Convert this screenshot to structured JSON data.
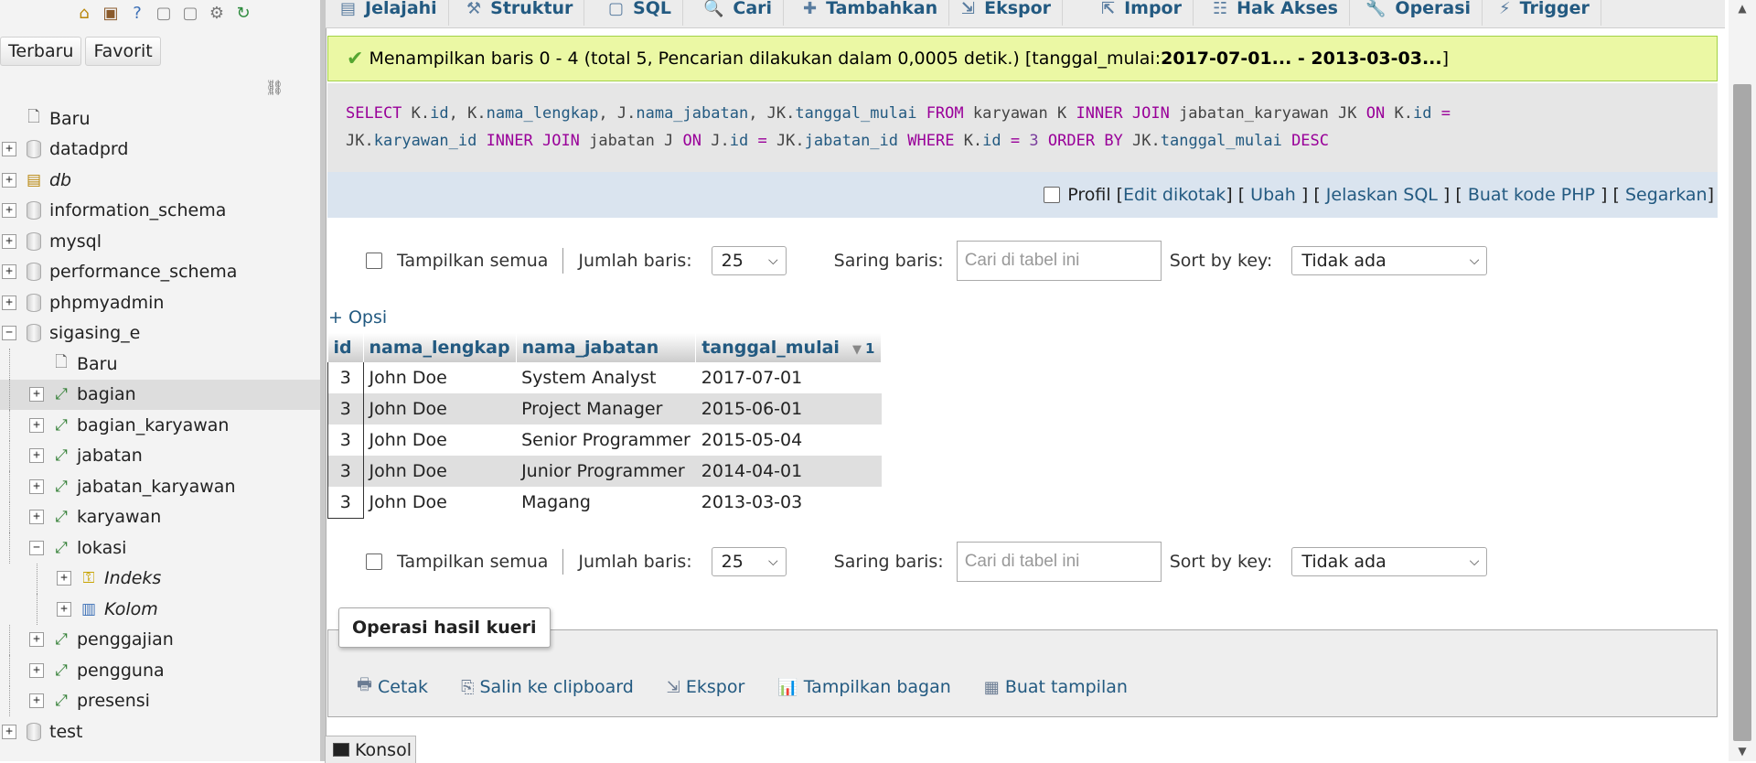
{
  "navigation": {
    "top_icons": [
      {
        "name": "home-icon",
        "glyph": "⌂"
      },
      {
        "name": "logout-icon",
        "glyph": "▣"
      },
      {
        "name": "help-icon",
        "glyph": "?"
      },
      {
        "name": "docs-icon",
        "glyph": "▢"
      },
      {
        "name": "copy-icon",
        "glyph": "▢"
      },
      {
        "name": "settings-icon",
        "glyph": "⚙"
      },
      {
        "name": "reload-icon",
        "glyph": "↻"
      }
    ],
    "tabs": [
      "Terbaru",
      "Favorit"
    ],
    "tree": [
      {
        "label": "Baru",
        "level": 0,
        "expander": "",
        "icon": "new-icon",
        "italic": false
      },
      {
        "label": "datadprd",
        "level": 0,
        "expander": "+",
        "icon": "database-icon",
        "italic": false
      },
      {
        "label": "db",
        "level": 0,
        "expander": "+",
        "icon": "database-group-icon",
        "italic": true
      },
      {
        "label": "information_schema",
        "level": 0,
        "expander": "+",
        "icon": "database-icon",
        "italic": false
      },
      {
        "label": "mysql",
        "level": 0,
        "expander": "+",
        "icon": "database-icon",
        "italic": false
      },
      {
        "label": "performance_schema",
        "level": 0,
        "expander": "+",
        "icon": "database-icon",
        "italic": false
      },
      {
        "label": "phpmyadmin",
        "level": 0,
        "expander": "+",
        "icon": "database-icon",
        "italic": false
      },
      {
        "label": "sigasing_e",
        "level": 0,
        "expander": "−",
        "icon": "database-icon",
        "italic": false
      },
      {
        "label": "Baru",
        "level": 1,
        "expander": "",
        "icon": "new-table-icon",
        "italic": false
      },
      {
        "label": "bagian",
        "level": 1,
        "expander": "+",
        "icon": "table-icon",
        "italic": false,
        "highlight": true
      },
      {
        "label": "bagian_karyawan",
        "level": 1,
        "expander": "+",
        "icon": "table-icon",
        "italic": false
      },
      {
        "label": "jabatan",
        "level": 1,
        "expander": "+",
        "icon": "table-icon",
        "italic": false
      },
      {
        "label": "jabatan_karyawan",
        "level": 1,
        "expander": "+",
        "icon": "table-icon",
        "italic": false
      },
      {
        "label": "karyawan",
        "level": 1,
        "expander": "+",
        "icon": "table-icon",
        "italic": false
      },
      {
        "label": "lokasi",
        "level": 1,
        "expander": "−",
        "icon": "table-icon",
        "italic": false
      },
      {
        "label": "Indeks",
        "level": 2,
        "expander": "+",
        "icon": "index-icon",
        "italic": true
      },
      {
        "label": "Kolom",
        "level": 2,
        "expander": "+",
        "icon": "columns-icon",
        "italic": true
      },
      {
        "label": "penggajian",
        "level": 1,
        "expander": "+",
        "icon": "table-icon",
        "italic": false
      },
      {
        "label": "pengguna",
        "level": 1,
        "expander": "+",
        "icon": "table-icon",
        "italic": false
      },
      {
        "label": "presensi",
        "level": 1,
        "expander": "+",
        "icon": "table-icon",
        "italic": false
      },
      {
        "label": "test",
        "level": 0,
        "expander": "+",
        "icon": "database-icon",
        "italic": false
      }
    ]
  },
  "top_menu": [
    {
      "label": "Jelajahi",
      "icon": "browse-icon"
    },
    {
      "label": "Struktur",
      "icon": "structure-icon"
    },
    {
      "label": "SQL",
      "icon": "sql-icon"
    },
    {
      "label": "Cari",
      "icon": "search-icon"
    },
    {
      "label": "Tambahkan",
      "icon": "insert-icon"
    },
    {
      "label": "Ekspor",
      "icon": "export-icon"
    },
    {
      "label": "Impor",
      "icon": "import-icon"
    },
    {
      "label": "Hak Akses",
      "icon": "privileges-icon"
    },
    {
      "label": "Operasi",
      "icon": "operations-icon"
    },
    {
      "label": "Trigger",
      "icon": "trigger-icon"
    }
  ],
  "notice": {
    "text": "Menampilkan baris 0 - 4 (total 5, Pencarian dilakukan dalam 0,0005 detik.) [tanggal_mulai: ",
    "range": "2017-07-01... - 2013-03-03...",
    "close": "]"
  },
  "sql": {
    "line1": [
      {
        "t": "SELECT",
        "c": "kw"
      },
      {
        "t": " K.",
        "c": ""
      },
      {
        "t": "id",
        "c": "fld"
      },
      {
        "t": ", K.",
        "c": ""
      },
      {
        "t": "nama_lengkap",
        "c": "fld"
      },
      {
        "t": ", J.",
        "c": ""
      },
      {
        "t": "nama_jabatan",
        "c": "fld"
      },
      {
        "t": ", JK.",
        "c": ""
      },
      {
        "t": "tanggal_mulai",
        "c": "fld"
      },
      {
        "t": " ",
        "c": ""
      },
      {
        "t": "FROM",
        "c": "kw"
      },
      {
        "t": " karyawan K ",
        "c": ""
      },
      {
        "t": "INNER JOIN",
        "c": "kw"
      },
      {
        "t": " jabatan_karyawan JK ",
        "c": ""
      },
      {
        "t": "ON",
        "c": "kw"
      },
      {
        "t": " K.",
        "c": ""
      },
      {
        "t": "id",
        "c": "fld"
      },
      {
        "t": " ",
        "c": ""
      },
      {
        "t": "=",
        "c": "kw"
      }
    ],
    "line2": [
      {
        "t": "JK.",
        "c": ""
      },
      {
        "t": "karyawan_id",
        "c": "fld"
      },
      {
        "t": " ",
        "c": ""
      },
      {
        "t": "INNER JOIN",
        "c": "kw"
      },
      {
        "t": " jabatan J ",
        "c": ""
      },
      {
        "t": "ON",
        "c": "kw"
      },
      {
        "t": " J.",
        "c": ""
      },
      {
        "t": "id",
        "c": "fld"
      },
      {
        "t": " ",
        "c": ""
      },
      {
        "t": "=",
        "c": "kw"
      },
      {
        "t": " JK.",
        "c": ""
      },
      {
        "t": "jabatan_id",
        "c": "fld"
      },
      {
        "t": " ",
        "c": ""
      },
      {
        "t": "WHERE",
        "c": "kw"
      },
      {
        "t": " K.",
        "c": ""
      },
      {
        "t": "id",
        "c": "fld"
      },
      {
        "t": " ",
        "c": ""
      },
      {
        "t": "=",
        "c": "kw"
      },
      {
        "t": " ",
        "c": ""
      },
      {
        "t": "3",
        "c": "num"
      },
      {
        "t": " ",
        "c": ""
      },
      {
        "t": "ORDER BY",
        "c": "kw"
      },
      {
        "t": " JK.",
        "c": ""
      },
      {
        "t": "tanggal_mulai",
        "c": "fld"
      },
      {
        "t": " ",
        "c": ""
      },
      {
        "t": "DESC",
        "c": "kw"
      }
    ]
  },
  "profile_bar": {
    "profil": "Profil",
    "edit_inline": "Edit dikotak",
    "ubah": "Ubah",
    "jelaskan": "Jelaskan SQL",
    "buat_kode": "Buat kode PHP",
    "segarkan": "Segarkan"
  },
  "row_controls": {
    "show_all": "Tampilkan semua",
    "rows_label": "Jumlah baris:",
    "rows_value": "25",
    "filter_label": "Saring baris:",
    "filter_placeholder": "Cari di tabel ini",
    "sort_label": "Sort by key:",
    "sort_value": "Tidak ada"
  },
  "options_link": "+ Opsi",
  "table": {
    "columns": [
      "id",
      "nama_lengkap",
      "nama_jabatan",
      "tanggal_mulai"
    ],
    "sort_index": "1",
    "rows": [
      [
        "3",
        "John Doe",
        "System Analyst",
        "2017-07-01"
      ],
      [
        "3",
        "John Doe",
        "Project Manager",
        "2015-06-01"
      ],
      [
        "3",
        "John Doe",
        "Senior Programmer",
        "2015-05-04"
      ],
      [
        "3",
        "John Doe",
        "Junior Programmer",
        "2014-04-01"
      ],
      [
        "3",
        "John Doe",
        "Magang",
        "2013-03-03"
      ]
    ]
  },
  "query_ops": {
    "legend": "Operasi hasil kueri",
    "items": [
      {
        "label": "Cetak",
        "icon": "print-icon"
      },
      {
        "label": "Salin ke clipboard",
        "icon": "clipboard-icon"
      },
      {
        "label": "Ekspor",
        "icon": "export-icon"
      },
      {
        "label": "Tampilkan bagan",
        "icon": "chart-icon"
      },
      {
        "label": "Buat tampilan",
        "icon": "create-view-icon"
      }
    ]
  },
  "console": "Konsol",
  "colors": {
    "link": "#235a81",
    "notice_bg": "#ebf8a4",
    "sql_keyword": "#990099"
  }
}
